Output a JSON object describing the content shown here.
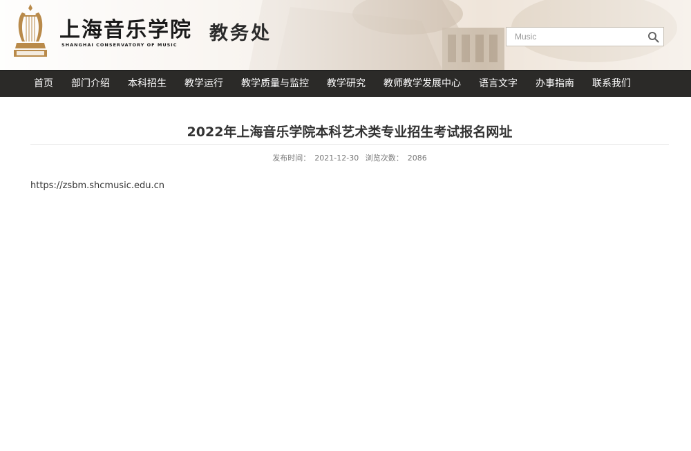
{
  "header": {
    "school_name_cn": "上海音乐学院",
    "school_name_en": "SHANGHAI CONSERVATORY OF MUSIC",
    "office_title": "教务处"
  },
  "search": {
    "placeholder": "Music",
    "button_icon": "search-icon"
  },
  "nav": {
    "items": [
      {
        "label": "首页"
      },
      {
        "label": "部门介绍"
      },
      {
        "label": "本科招生"
      },
      {
        "label": "教学运行"
      },
      {
        "label": "教学质量与监控"
      },
      {
        "label": "教学研究"
      },
      {
        "label": "教师教学发展中心"
      },
      {
        "label": "语言文字"
      },
      {
        "label": "办事指南"
      },
      {
        "label": "联系我们"
      }
    ]
  },
  "article": {
    "title": "2022年上海音乐学院本科艺术类专业招生考试报名网址",
    "publish_label": "发布时间：",
    "publish_date": "2021-12-30",
    "views_label": "浏览次数：",
    "views_count": "2086",
    "body_link": "https://zsbm.shcmusic.edu.cn"
  },
  "colors": {
    "nav_bg": "#2b2a28",
    "logo_gold": "#b98a4a",
    "header_bg": "#f7f1ea"
  }
}
